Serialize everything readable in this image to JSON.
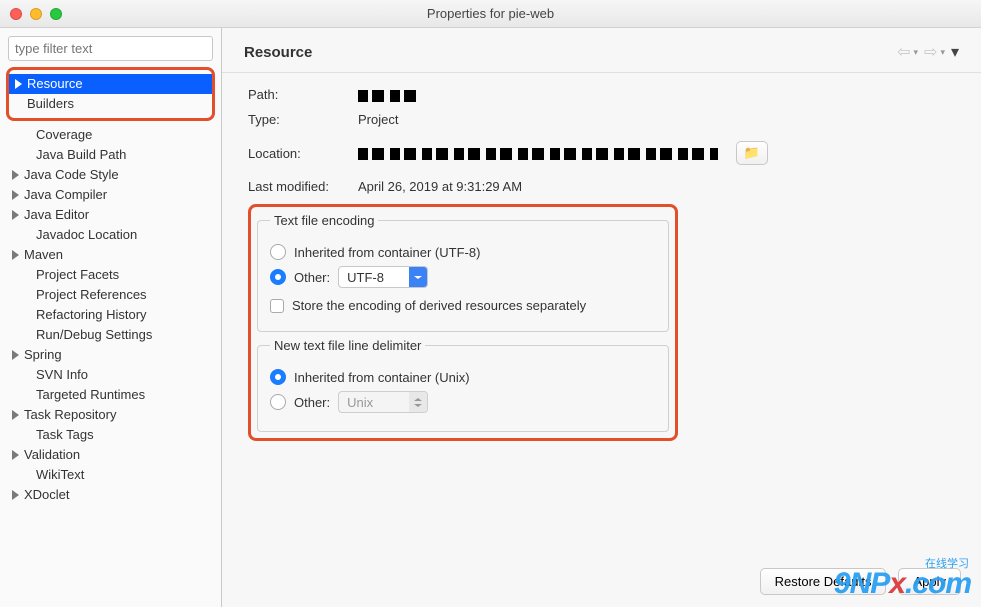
{
  "window": {
    "title": "Properties for pie-web"
  },
  "sidebar": {
    "filter_placeholder": "type filter text",
    "top": [
      {
        "label": "Resource",
        "selected": true,
        "has_children": true
      },
      {
        "label": "Builders",
        "has_children": false
      }
    ],
    "items": [
      {
        "label": "Coverage",
        "child": true
      },
      {
        "label": "Java Build Path",
        "child": true
      },
      {
        "label": "Java Code Style",
        "has_children": true
      },
      {
        "label": "Java Compiler",
        "has_children": true
      },
      {
        "label": "Java Editor",
        "has_children": true
      },
      {
        "label": "Javadoc Location",
        "child": true
      },
      {
        "label": "Maven",
        "has_children": true
      },
      {
        "label": "Project Facets",
        "child": true
      },
      {
        "label": "Project References",
        "child": true
      },
      {
        "label": "Refactoring History",
        "child": true
      },
      {
        "label": "Run/Debug Settings",
        "child": true
      },
      {
        "label": "Spring",
        "has_children": true
      },
      {
        "label": "SVN Info",
        "child": true
      },
      {
        "label": "Targeted Runtimes",
        "child": true
      },
      {
        "label": "Task Repository",
        "has_children": true
      },
      {
        "label": "Task Tags",
        "child": true
      },
      {
        "label": "Validation",
        "has_children": true
      },
      {
        "label": "WikiText",
        "child": true
      },
      {
        "label": "XDoclet",
        "has_children": true
      }
    ]
  },
  "main": {
    "heading": "Resource",
    "rows": {
      "path_label": "Path:",
      "type_label": "Type:",
      "type_value": "Project",
      "location_label": "Location:",
      "last_modified_label": "Last modified:",
      "last_modified_value": "April 26, 2019 at 9:31:29 AM"
    },
    "encoding": {
      "legend": "Text file encoding",
      "inherited_label": "Inherited from container (UTF-8)",
      "other_label": "Other:",
      "other_value": "UTF-8",
      "store_label": "Store the encoding of derived resources separately"
    },
    "delimiter": {
      "legend": "New text file line delimiter",
      "inherited_label": "Inherited from container (Unix)",
      "other_label": "Other:",
      "other_value": "Unix"
    },
    "buttons": {
      "restore": "Restore Defaults",
      "apply": "Apply"
    }
  },
  "watermark": {
    "text_a": "9NP",
    "text_b": "x",
    "text_c": ".com",
    "sub": "在线学习"
  }
}
